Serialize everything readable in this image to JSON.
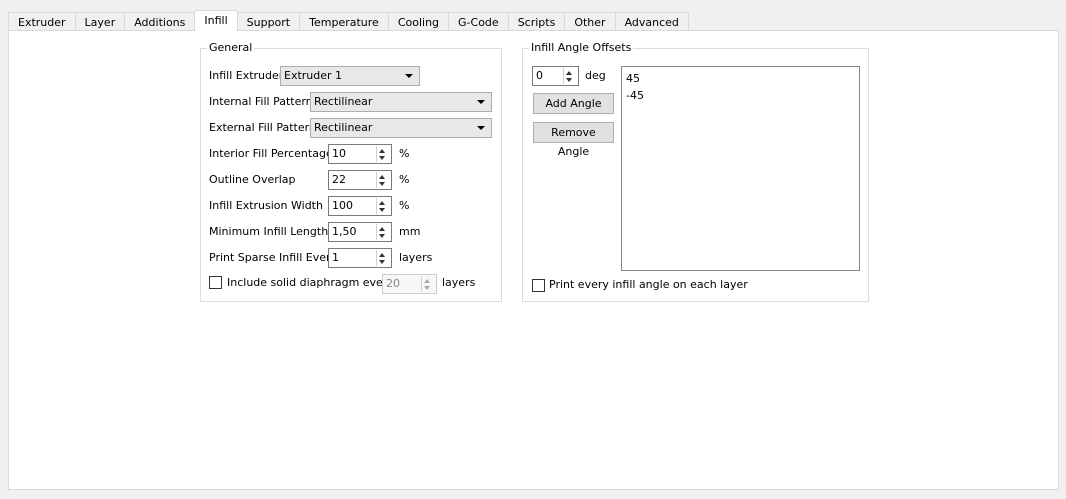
{
  "tabs": [
    {
      "label": "Extruder"
    },
    {
      "label": "Layer"
    },
    {
      "label": "Additions"
    },
    {
      "label": "Infill"
    },
    {
      "label": "Support"
    },
    {
      "label": "Temperature"
    },
    {
      "label": "Cooling"
    },
    {
      "label": "G-Code"
    },
    {
      "label": "Scripts"
    },
    {
      "label": "Other"
    },
    {
      "label": "Advanced"
    }
  ],
  "active_tab": "Infill",
  "general": {
    "title": "General",
    "infill_extruder": {
      "label": "Infill Extruder",
      "value": "Extruder 1"
    },
    "internal_fill_pattern": {
      "label": "Internal Fill Pattern",
      "value": "Rectilinear"
    },
    "external_fill_pattern": {
      "label": "External Fill Pattern",
      "value": "Rectilinear"
    },
    "interior_fill_percentage": {
      "label": "Interior Fill Percentage",
      "value": "10",
      "unit": "%"
    },
    "outline_overlap": {
      "label": "Outline Overlap",
      "value": "22",
      "unit": "%"
    },
    "infill_extrusion_width": {
      "label": "Infill Extrusion Width",
      "value": "100",
      "unit": "%"
    },
    "minimum_infill_length": {
      "label": "Minimum Infill Length",
      "value": "1,50",
      "unit": "mm"
    },
    "print_sparse_infill_every": {
      "label": "Print Sparse Infill Every",
      "value": "1",
      "unit": "layers"
    },
    "include_solid_diaphragm": {
      "label": "Include solid diaphragm every",
      "checked": false,
      "value": "20",
      "unit": "layers"
    }
  },
  "angle_offsets": {
    "title": "Infill Angle Offsets",
    "angle_input": {
      "value": "0",
      "unit": "deg"
    },
    "add_label": "Add Angle",
    "remove_label": "Remove Angle",
    "angles": [
      "45",
      "-45"
    ],
    "print_every_angle": {
      "label": "Print every infill angle on each layer",
      "checked": false
    }
  }
}
